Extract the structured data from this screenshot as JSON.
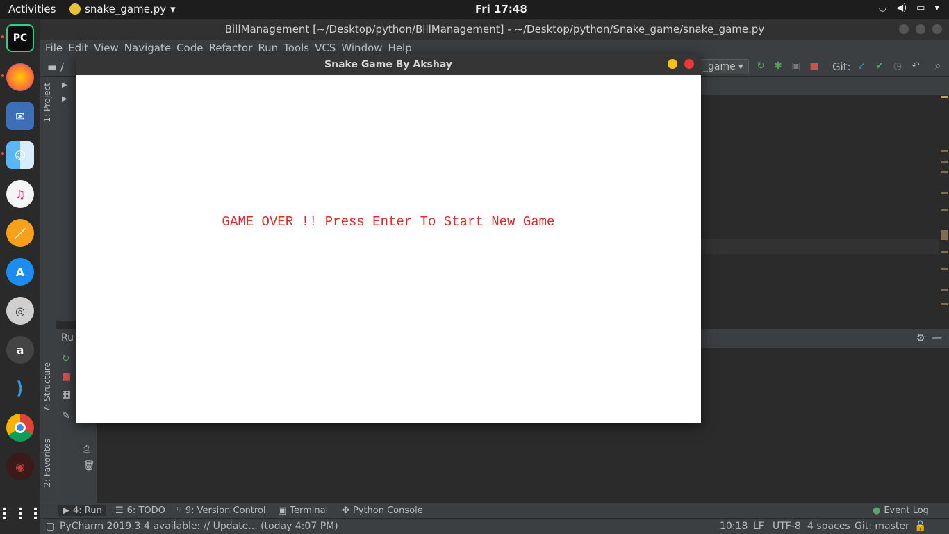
{
  "topbar": {
    "activities": "Activities",
    "app_menu": "snake_game.py",
    "clock": "Fri 17:48"
  },
  "ide": {
    "window_title": "BillManagement [~/Desktop/python/BillManagement] - ~/Desktop/python/Snake_game/snake_game.py",
    "menu": [
      "File",
      "Edit",
      "View",
      "Navigate",
      "Code",
      "Refactor",
      "Run",
      "Tools",
      "VCS",
      "Window",
      "Help"
    ],
    "breadcrumb": "/",
    "run_config": "_game",
    "git_label": "Git:",
    "left_tabs": {
      "project": "1: Project",
      "structure": "7: Structure",
      "favorites": "2: Favorites"
    },
    "run_panel_label": "Ru",
    "bottom_tabs": [
      {
        "id": "run",
        "label": "4: Run"
      },
      {
        "id": "todo",
        "label": "6: TODO"
      },
      {
        "id": "vcs",
        "label": "9: Version Control"
      },
      {
        "id": "terminal",
        "label": "Terminal"
      },
      {
        "id": "console",
        "label": "Python Console"
      },
      {
        "id": "event",
        "label": "Event Log"
      }
    ],
    "status": {
      "message": "PyCharm 2019.3.4 available: // Update... (today 4:07 PM)",
      "position": "10:18",
      "line_sep": "LF",
      "encoding": "UTF-8",
      "indent": "4 spaces",
      "branch": "Git: master"
    }
  },
  "game": {
    "title": "Snake Game By Akshay",
    "message": "GAME OVER !! Press Enter To Start New Game",
    "message_color": "#e02a2a"
  },
  "dock": [
    "pycharm-icon",
    "firefox-icon",
    "thunderbird-icon",
    "finder-icon",
    "music-icon",
    "notes-icon",
    "appstore-icon",
    "settings-icon",
    "amazon-icon",
    "vscode-icon",
    "chrome-icon",
    "game-icon",
    "apps-grid-icon"
  ]
}
